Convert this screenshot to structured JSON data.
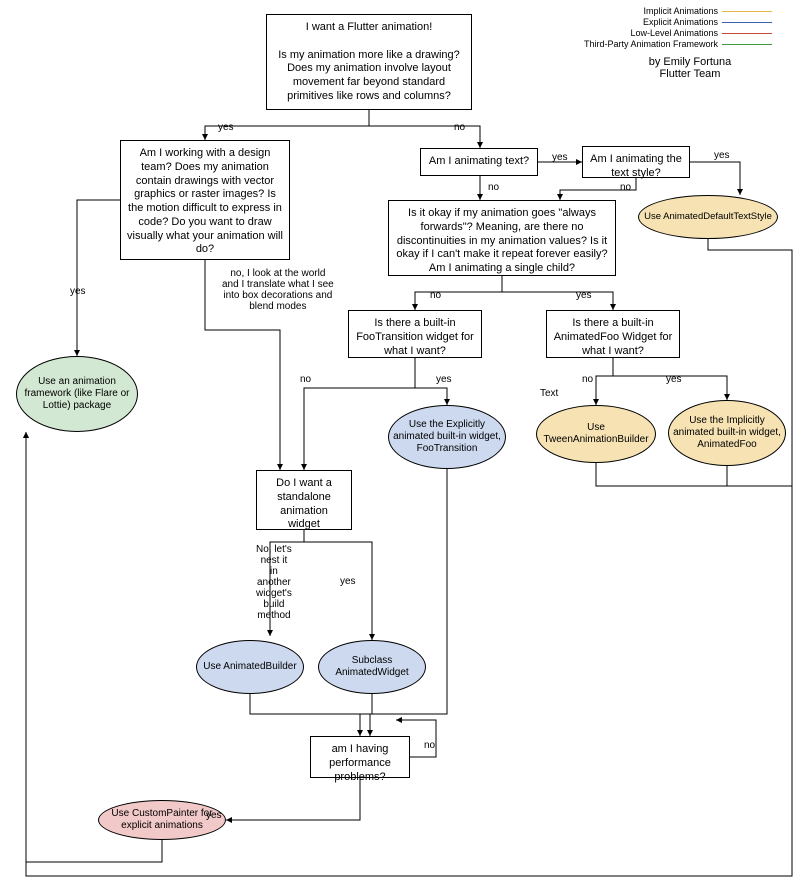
{
  "legend": {
    "l1": "Implicit Animations",
    "l2": "Explicit Animations",
    "l3": "Low-Level Animations",
    "l4": "Third-Party Animation Framework",
    "credit": "by Emily Fortuna\nFlutter Team"
  },
  "colors": {
    "implicit": "#e2b84a",
    "explicit": "#3a5fb5",
    "lowlevel": "#c9473a",
    "thirdparty": "#3c9a3c"
  },
  "edges": {
    "yes": "yes",
    "no": "no",
    "text": "Text",
    "translate": "no, I look at the world\nand I translate what I see\ninto box decorations and\nblend modes",
    "nest": "No, let's\nnest it\nin\nanother\nwidget's\nbuild\nmethod"
  },
  "nodes": {
    "start": "I want a Flutter animation!\n\nIs my animation more like a drawing? Does my animation involve layout movement far beyond standard primitives like rows and columns?",
    "design": "Am I working with a design team? Does my animation contain drawings with vector graphics or raster images? Is the motion difficult to express in code? Do you want to draw visually what your animation will do?",
    "animText": "Am I animating text?",
    "textStyle": "Am I animating the text style?",
    "adt": "Use AnimatedDefaultTextStyle",
    "forwards": "Is it okay if my animation goes \"always forwards\"? Meaning, are there no discontinuities in my animation values? Is it okay if I can't make it repeat forever easily? Am I animating a single child?",
    "fooTrans": "Is there a built-in FooTransition widget for what I want?",
    "animFoo": "Is there a built-in AnimatedFoo Widget for what I want?",
    "useFooTrans": "Use the Explicitly animated built-in widget, FooTransition",
    "useTween": "Use TweenAnimationBuilder",
    "useAnimFoo": "Use the Implicitly animated built-in widget, AnimatedFoo",
    "standalone": "Do I want a standalone animation widget",
    "useAB": "Use AnimatedBuilder",
    "subAW": "Subclass AnimatedWidget",
    "perf": "am I having performance problems?",
    "custom": "Use CustomPainter for explicit animations",
    "framework": "Use an animation framework (like Flare or Lottie) package"
  }
}
